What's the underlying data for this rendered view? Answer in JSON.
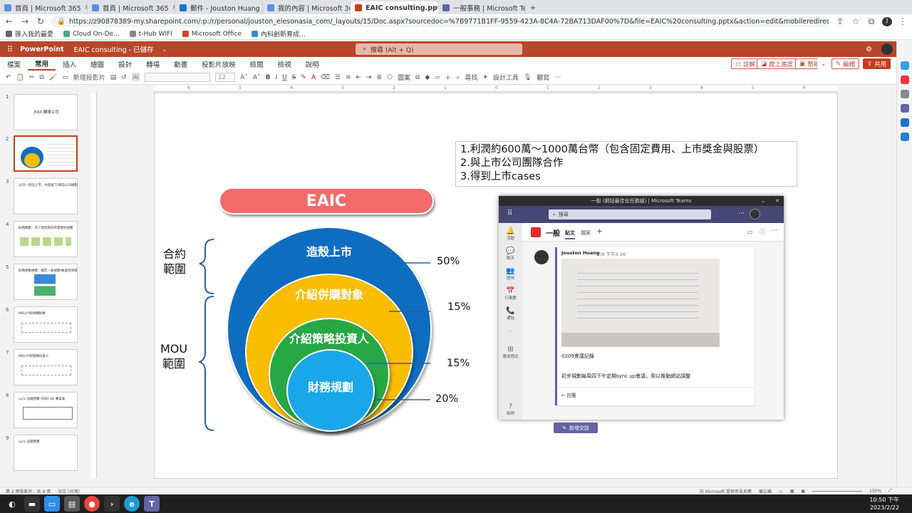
{
  "browser": {
    "tabs": [
      {
        "label": "首頁 | Microsoft 365",
        "color": "#5f8ee8"
      },
      {
        "label": "首頁 | Microsoft 365",
        "color": "#5f8ee8"
      },
      {
        "label": "郵件 - Jouston Huang - Ou",
        "color": "#1a73c8"
      },
      {
        "label": "我的內容 | Microsoft 365",
        "color": "#5f8ee8"
      },
      {
        "label": "EAIC consulting.pptx",
        "color": "#c43e1c"
      },
      {
        "label": "一般事務 | Microsoft Tea",
        "color": "#6264a7"
      }
    ],
    "new_tab": "+",
    "url": "https://z90878389-my.sharepoint.com/:p:/r/personal/jouston_elesonasia_com/_layouts/15/Doc.aspx?sourcedoc=%7B9771B1FF-9559-423A-8C4A-72BA713DAF00%7D&file=EAIC%20consulting.pptx&action=edit&mobileredirect=true&DefaultItemOpen=1&login_hint=jo...",
    "bookmarks": [
      "匯入我的最愛",
      "Cloud On-De...",
      "t-Hub WIFI",
      "Microsoft Office",
      "內科創新育成..."
    ]
  },
  "ppt": {
    "app_name": "PowerPoint",
    "doc_title": "EAIC consulting  -  已儲存",
    "search_placeholder": "搜尋 (Alt + Q)",
    "menus": [
      "檔案",
      "常用",
      "插入",
      "繪圖",
      "設計",
      "轉場",
      "動畫",
      "投影片放映",
      "檢閱",
      "檢視",
      "說明"
    ],
    "active_menu": "常用",
    "right_buttons": {
      "comments": "註解",
      "catch_up": "趕上進度",
      "present": "簡報",
      "editing": "編輯",
      "share": "共用"
    },
    "toolbar": {
      "new_slide": "新增投影片",
      "font_size": "12",
      "drawing": "圖案",
      "find": "尋找",
      "designer": "設計工具",
      "viewer": "聽寫"
    },
    "status": {
      "slide_info": "第 2 張投影片，共 9 張",
      "language": "中文 (台灣)",
      "feedback": "向 Microsoft 提供意見反應",
      "notes": "備忘稿",
      "zoom": "150%"
    }
  },
  "thumbnails": [
    {
      "num": "1",
      "title": "EAIC輔導公司"
    },
    {
      "num": "2",
      "title": ""
    },
    {
      "num": "3",
      "title": "公司---目前上市，內容如下/目前公司規劃"
    },
    {
      "num": "4",
      "title": "財務規劃：為了達到目的所需要的調整"
    },
    {
      "num": "5",
      "title": "財務規劃規模：確定一般規劃/要達到項目"
    },
    {
      "num": "6",
      "title": "MOU介紹併購對象"
    },
    {
      "num": "7",
      "title": "MOU介紹策略投資人"
    },
    {
      "num": "8",
      "title": "sync 追蹤匯聚 的DD SD 專案會"
    },
    {
      "num": "9",
      "title": "sync 追蹤匯聚"
    }
  ],
  "slide": {
    "textbox_lines": [
      "1.利潤約600萬～1000萬台幣（包含固定費用、上市獎金與股票）",
      "2.與上市公司團隊合作",
      "3.得到上市cases"
    ],
    "eaic_label": "EAIC",
    "circles": [
      {
        "label": "造殼上市",
        "color": "#0f6dc0",
        "pct": "50%"
      },
      {
        "label": "介紹併購對象",
        "color": "#f9bd00",
        "pct": "15%"
      },
      {
        "label": "介紹策略投資人",
        "color": "#27a845",
        "pct": "15%"
      },
      {
        "label": "財務規劃",
        "color": "#1aa7ea",
        "pct": "20%"
      }
    ],
    "contract_scope": [
      "合約",
      "範圍"
    ],
    "mou_scope": [
      "MOU",
      "範圍"
    ]
  },
  "teams": {
    "window_title": "一般 (網站最佳化任務組) | Microsoft Teams",
    "search": "搜尋",
    "rail": [
      "活動",
      "聊天",
      "團隊",
      "行事曆",
      "通話",
      "...",
      "應用程式",
      "說明"
    ],
    "channel": "一般",
    "channel_tabs": [
      "貼文",
      "檔案"
    ],
    "post": {
      "author": "Jouston Huang",
      "time": "2/9 下午3:16",
      "caption": "0209會議記錄",
      "text": "初步規劃每周四下午定期sync up會議，用以推動網站調整",
      "reply": "回覆"
    },
    "new_conversation": "新增交談"
  },
  "taskbar": {
    "time": "10:50 下午",
    "date": "2023/2/22"
  }
}
